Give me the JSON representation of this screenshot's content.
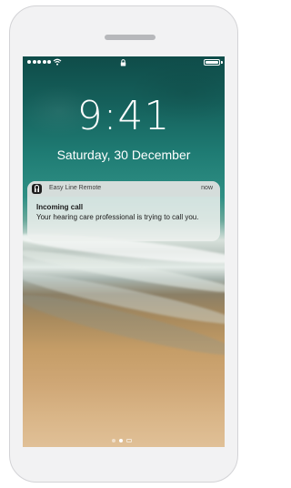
{
  "status_bar": {
    "signal_icon": "signal-dots-icon",
    "wifi_icon": "wifi-icon",
    "lock_icon": "lock-icon",
    "battery_icon": "battery-icon",
    "battery_level": 1.0
  },
  "lock_screen": {
    "time": "9:41",
    "date": "Saturday, 30 December"
  },
  "notification": {
    "app_icon": "easy-line-remote-app-icon",
    "app_name": "Easy Line Remote",
    "time": "now",
    "title": "Incoming call",
    "body": "Your hearing care professional is trying to call you."
  },
  "page_indicator": {
    "count": 3,
    "active_index": 1
  },
  "colors": {
    "text_on_wallpaper": "#ffffff",
    "notification_bg": "#ecf0ee",
    "device_frame": "#f2f2f3"
  }
}
